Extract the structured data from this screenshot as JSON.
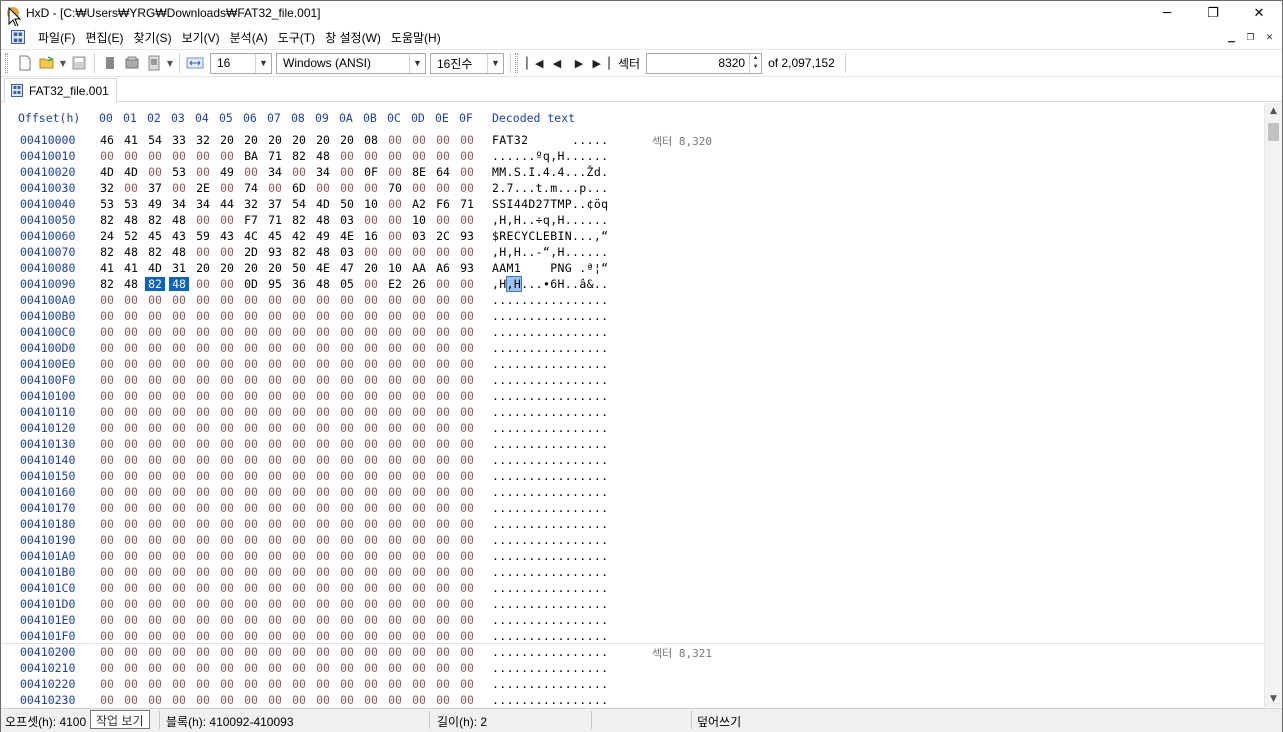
{
  "window": {
    "title": "HxD - [C:₩Users₩YRG₩Downloads₩FAT32_file.001]",
    "minimize": "─",
    "maximize": "❐",
    "close": "✕"
  },
  "menu": {
    "items": [
      "파일(F)",
      "편집(E)",
      "찾기(S)",
      "보기(V)",
      "분석(A)",
      "도구(T)",
      "창 설정(W)",
      "도움말(H)"
    ]
  },
  "toolbar": {
    "bytes_per_row": "16",
    "charset": "Windows (ANSI)",
    "offset_base": "16진수",
    "sector_label": "섹터",
    "sector_value": "8320",
    "sector_total": "of 2,097,152"
  },
  "tabs": [
    {
      "label": "FAT32_file.001"
    }
  ],
  "hex": {
    "offset_header": "Offset(h)",
    "column_headers": [
      "00",
      "01",
      "02",
      "03",
      "04",
      "05",
      "06",
      "07",
      "08",
      "09",
      "0A",
      "0B",
      "0C",
      "0D",
      "0E",
      "0F"
    ],
    "decoded_header": "Decoded text",
    "rows": [
      {
        "offset": "00410000",
        "bytes": [
          "46",
          "41",
          "54",
          "33",
          "32",
          "20",
          "20",
          "20",
          "20",
          "20",
          "20",
          "08",
          "00",
          "00",
          "00",
          "00"
        ],
        "text": "FAT32      .....",
        "sector": "섹터 8,320"
      },
      {
        "offset": "00410010",
        "bytes": [
          "00",
          "00",
          "00",
          "00",
          "00",
          "00",
          "BA",
          "71",
          "82",
          "48",
          "00",
          "00",
          "00",
          "00",
          "00",
          "00"
        ],
        "text": "......ºq,H......"
      },
      {
        "offset": "00410020",
        "bytes": [
          "4D",
          "4D",
          "00",
          "53",
          "00",
          "49",
          "00",
          "34",
          "00",
          "34",
          "00",
          "0F",
          "00",
          "8E",
          "64",
          "00"
        ],
        "text": "MM.S.I.4.4...Žd."
      },
      {
        "offset": "00410030",
        "bytes": [
          "32",
          "00",
          "37",
          "00",
          "2E",
          "00",
          "74",
          "00",
          "6D",
          "00",
          "00",
          "00",
          "70",
          "00",
          "00",
          "00"
        ],
        "text": "2.7...t.m...p..."
      },
      {
        "offset": "00410040",
        "bytes": [
          "53",
          "53",
          "49",
          "34",
          "34",
          "44",
          "32",
          "37",
          "54",
          "4D",
          "50",
          "10",
          "00",
          "A2",
          "F6",
          "71"
        ],
        "text": "SSI44D27TMP..¢öq"
      },
      {
        "offset": "00410050",
        "bytes": [
          "82",
          "48",
          "82",
          "48",
          "00",
          "00",
          "F7",
          "71",
          "82",
          "48",
          "03",
          "00",
          "00",
          "10",
          "00",
          "00"
        ],
        "text": ",H,H..÷q,H......"
      },
      {
        "offset": "00410060",
        "bytes": [
          "24",
          "52",
          "45",
          "43",
          "59",
          "43",
          "4C",
          "45",
          "42",
          "49",
          "4E",
          "16",
          "00",
          "03",
          "2C",
          "93"
        ],
        "text": "$RECYCLEBIN...,“"
      },
      {
        "offset": "00410070",
        "bytes": [
          "82",
          "48",
          "82",
          "48",
          "00",
          "00",
          "2D",
          "93",
          "82",
          "48",
          "03",
          "00",
          "00",
          "00",
          "00",
          "00"
        ],
        "text": ",H,H..-“,H......"
      },
      {
        "offset": "00410080",
        "bytes": [
          "41",
          "41",
          "4D",
          "31",
          "20",
          "20",
          "20",
          "20",
          "50",
          "4E",
          "47",
          "20",
          "10",
          "AA",
          "A6",
          "93"
        ],
        "text": "AAM1    PNG .ª¦“"
      },
      {
        "offset": "00410090",
        "bytes": [
          "82",
          "48",
          "82",
          "48",
          "00",
          "00",
          "0D",
          "95",
          "36",
          "48",
          "05",
          "00",
          "E2",
          "26",
          "00",
          "00"
        ],
        "text": ",H,H...•6H..â&..",
        "sel": [
          2,
          3
        ]
      },
      {
        "offset": "004100A0",
        "bytes": [
          "00",
          "00",
          "00",
          "00",
          "00",
          "00",
          "00",
          "00",
          "00",
          "00",
          "00",
          "00",
          "00",
          "00",
          "00",
          "00"
        ],
        "text": "................"
      },
      {
        "offset": "004100B0",
        "bytes": [
          "00",
          "00",
          "00",
          "00",
          "00",
          "00",
          "00",
          "00",
          "00",
          "00",
          "00",
          "00",
          "00",
          "00",
          "00",
          "00"
        ],
        "text": "................"
      },
      {
        "offset": "004100C0",
        "bytes": [
          "00",
          "00",
          "00",
          "00",
          "00",
          "00",
          "00",
          "00",
          "00",
          "00",
          "00",
          "00",
          "00",
          "00",
          "00",
          "00"
        ],
        "text": "................"
      },
      {
        "offset": "004100D0",
        "bytes": [
          "00",
          "00",
          "00",
          "00",
          "00",
          "00",
          "00",
          "00",
          "00",
          "00",
          "00",
          "00",
          "00",
          "00",
          "00",
          "00"
        ],
        "text": "................"
      },
      {
        "offset": "004100E0",
        "bytes": [
          "00",
          "00",
          "00",
          "00",
          "00",
          "00",
          "00",
          "00",
          "00",
          "00",
          "00",
          "00",
          "00",
          "00",
          "00",
          "00"
        ],
        "text": "................"
      },
      {
        "offset": "004100F0",
        "bytes": [
          "00",
          "00",
          "00",
          "00",
          "00",
          "00",
          "00",
          "00",
          "00",
          "00",
          "00",
          "00",
          "00",
          "00",
          "00",
          "00"
        ],
        "text": "................"
      },
      {
        "offset": "00410100",
        "bytes": [
          "00",
          "00",
          "00",
          "00",
          "00",
          "00",
          "00",
          "00",
          "00",
          "00",
          "00",
          "00",
          "00",
          "00",
          "00",
          "00"
        ],
        "text": "................"
      },
      {
        "offset": "00410110",
        "bytes": [
          "00",
          "00",
          "00",
          "00",
          "00",
          "00",
          "00",
          "00",
          "00",
          "00",
          "00",
          "00",
          "00",
          "00",
          "00",
          "00"
        ],
        "text": "................"
      },
      {
        "offset": "00410120",
        "bytes": [
          "00",
          "00",
          "00",
          "00",
          "00",
          "00",
          "00",
          "00",
          "00",
          "00",
          "00",
          "00",
          "00",
          "00",
          "00",
          "00"
        ],
        "text": "................"
      },
      {
        "offset": "00410130",
        "bytes": [
          "00",
          "00",
          "00",
          "00",
          "00",
          "00",
          "00",
          "00",
          "00",
          "00",
          "00",
          "00",
          "00",
          "00",
          "00",
          "00"
        ],
        "text": "................"
      },
      {
        "offset": "00410140",
        "bytes": [
          "00",
          "00",
          "00",
          "00",
          "00",
          "00",
          "00",
          "00",
          "00",
          "00",
          "00",
          "00",
          "00",
          "00",
          "00",
          "00"
        ],
        "text": "................"
      },
      {
        "offset": "00410150",
        "bytes": [
          "00",
          "00",
          "00",
          "00",
          "00",
          "00",
          "00",
          "00",
          "00",
          "00",
          "00",
          "00",
          "00",
          "00",
          "00",
          "00"
        ],
        "text": "................"
      },
      {
        "offset": "00410160",
        "bytes": [
          "00",
          "00",
          "00",
          "00",
          "00",
          "00",
          "00",
          "00",
          "00",
          "00",
          "00",
          "00",
          "00",
          "00",
          "00",
          "00"
        ],
        "text": "................"
      },
      {
        "offset": "00410170",
        "bytes": [
          "00",
          "00",
          "00",
          "00",
          "00",
          "00",
          "00",
          "00",
          "00",
          "00",
          "00",
          "00",
          "00",
          "00",
          "00",
          "00"
        ],
        "text": "................"
      },
      {
        "offset": "00410180",
        "bytes": [
          "00",
          "00",
          "00",
          "00",
          "00",
          "00",
          "00",
          "00",
          "00",
          "00",
          "00",
          "00",
          "00",
          "00",
          "00",
          "00"
        ],
        "text": "................"
      },
      {
        "offset": "00410190",
        "bytes": [
          "00",
          "00",
          "00",
          "00",
          "00",
          "00",
          "00",
          "00",
          "00",
          "00",
          "00",
          "00",
          "00",
          "00",
          "00",
          "00"
        ],
        "text": "................"
      },
      {
        "offset": "004101A0",
        "bytes": [
          "00",
          "00",
          "00",
          "00",
          "00",
          "00",
          "00",
          "00",
          "00",
          "00",
          "00",
          "00",
          "00",
          "00",
          "00",
          "00"
        ],
        "text": "................"
      },
      {
        "offset": "004101B0",
        "bytes": [
          "00",
          "00",
          "00",
          "00",
          "00",
          "00",
          "00",
          "00",
          "00",
          "00",
          "00",
          "00",
          "00",
          "00",
          "00",
          "00"
        ],
        "text": "................"
      },
      {
        "offset": "004101C0",
        "bytes": [
          "00",
          "00",
          "00",
          "00",
          "00",
          "00",
          "00",
          "00",
          "00",
          "00",
          "00",
          "00",
          "00",
          "00",
          "00",
          "00"
        ],
        "text": "................"
      },
      {
        "offset": "004101D0",
        "bytes": [
          "00",
          "00",
          "00",
          "00",
          "00",
          "00",
          "00",
          "00",
          "00",
          "00",
          "00",
          "00",
          "00",
          "00",
          "00",
          "00"
        ],
        "text": "................"
      },
      {
        "offset": "004101E0",
        "bytes": [
          "00",
          "00",
          "00",
          "00",
          "00",
          "00",
          "00",
          "00",
          "00",
          "00",
          "00",
          "00",
          "00",
          "00",
          "00",
          "00"
        ],
        "text": "................"
      },
      {
        "offset": "004101F0",
        "bytes": [
          "00",
          "00",
          "00",
          "00",
          "00",
          "00",
          "00",
          "00",
          "00",
          "00",
          "00",
          "00",
          "00",
          "00",
          "00",
          "00"
        ],
        "text": "................"
      },
      {
        "offset": "00410200",
        "bytes": [
          "00",
          "00",
          "00",
          "00",
          "00",
          "00",
          "00",
          "00",
          "00",
          "00",
          "00",
          "00",
          "00",
          "00",
          "00",
          "00"
        ],
        "text": "................",
        "sector": "섹터 8,321"
      },
      {
        "offset": "00410210",
        "bytes": [
          "00",
          "00",
          "00",
          "00",
          "00",
          "00",
          "00",
          "00",
          "00",
          "00",
          "00",
          "00",
          "00",
          "00",
          "00",
          "00"
        ],
        "text": "................"
      },
      {
        "offset": "00410220",
        "bytes": [
          "00",
          "00",
          "00",
          "00",
          "00",
          "00",
          "00",
          "00",
          "00",
          "00",
          "00",
          "00",
          "00",
          "00",
          "00",
          "00"
        ],
        "text": "................"
      },
      {
        "offset": "00410230",
        "bytes": [
          "00",
          "00",
          "00",
          "00",
          "00",
          "00",
          "00",
          "00",
          "00",
          "00",
          "00",
          "00",
          "00",
          "00",
          "00",
          "00"
        ],
        "text": "................"
      }
    ]
  },
  "status": {
    "offset": "오프셋(h): 4100",
    "tooltip": "작업 보기",
    "block": "블록(h): 410092-410093",
    "length": "길이(h): 2",
    "mode": "덮어쓰기"
  }
}
